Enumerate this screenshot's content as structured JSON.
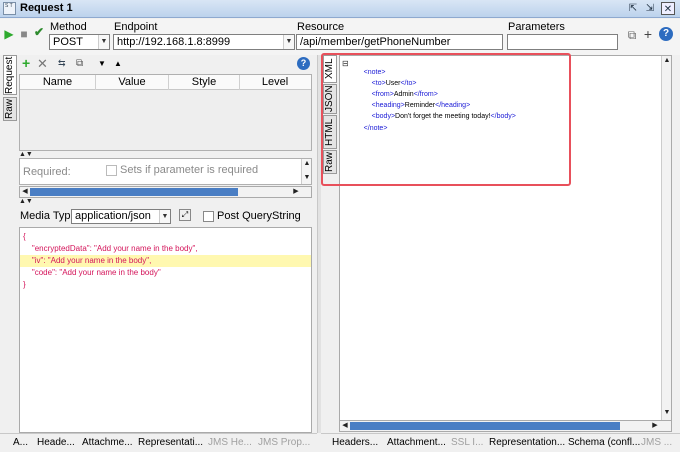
{
  "window": {
    "title": "Request 1",
    "icon_text": "S T"
  },
  "toolbar": {
    "method_label": "Method",
    "method_value": "POST",
    "endpoint_label": "Endpoint",
    "endpoint_value": "http://192.168.1.8:8999",
    "resource_label": "Resource",
    "resource_value": "/api/member/getPhoneNumber",
    "parameters_label": "Parameters",
    "parameters_value": ""
  },
  "request_panel": {
    "vtabs": [
      "Request",
      "Raw"
    ],
    "columns": [
      "Name",
      "Value",
      "Style",
      "Level"
    ],
    "required_label": "Required:",
    "sets_if_label": "Sets if parameter is required",
    "media_type_label": "Media Type",
    "media_type_value": "application/json",
    "post_querystring_label": "Post QueryString",
    "body_lines": [
      "{",
      "    \"encryptedData\": \"Add your name in the body\",",
      "    \"iv\": \"Add your name in the body\",",
      "    \"code\": \"Add your name in the body\"",
      "}"
    ]
  },
  "response_panel": {
    "vtabs": [
      "XML",
      "JSON",
      "HTML",
      "Raw"
    ],
    "xml": {
      "collapse_glyph": "⊟",
      "root_open": "<note>",
      "to": {
        "open": "<to>",
        "text": "User",
        "close": "</to>"
      },
      "from": {
        "open": "<from>",
        "text": "Admin",
        "close": "</from>"
      },
      "heading": {
        "open": "<heading>",
        "text": "Reminder",
        "close": "</heading>"
      },
      "body": {
        "open": "<body>",
        "text": "Don't forget the meeting today!",
        "close": "</body>"
      },
      "root_close": "</note>"
    }
  },
  "bottom_tabs_left": [
    {
      "label": "A...",
      "disabled": false
    },
    {
      "label": "Heade...",
      "disabled": false
    },
    {
      "label": "Attachme...",
      "disabled": false
    },
    {
      "label": "Representati...",
      "disabled": false
    },
    {
      "label": "JMS He...",
      "disabled": true
    },
    {
      "label": "JMS Prop...",
      "disabled": true
    }
  ],
  "bottom_tabs_right": [
    {
      "label": "Headers...",
      "disabled": false
    },
    {
      "label": "Attachment...",
      "disabled": false
    },
    {
      "label": "SSL I...",
      "disabled": true
    },
    {
      "label": "Representation...",
      "disabled": false
    },
    {
      "label": "Schema (confl...",
      "disabled": false
    },
    {
      "label": "JMS ...",
      "disabled": true
    }
  ],
  "colors": {
    "highlight_border": "#e8505b",
    "accent_blue": "#4a7ec4",
    "run_green": "#2eaa2e"
  }
}
